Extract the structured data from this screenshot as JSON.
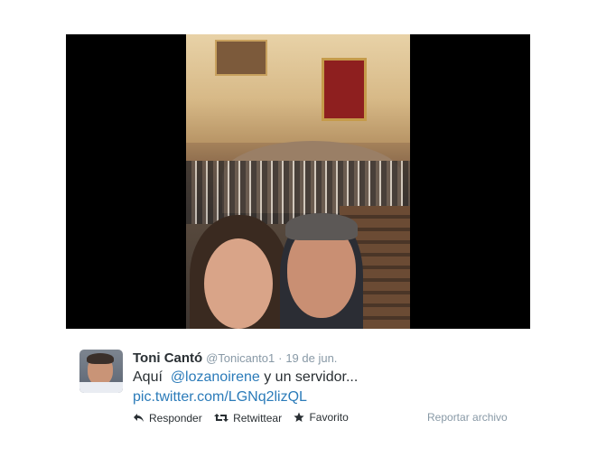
{
  "tweet": {
    "author_name": "Toni Cantó",
    "handle": "@Tonicanto1",
    "separator": "·",
    "timestamp": "19 de jun.",
    "text_prefix": "Aquí",
    "mention": "@lozanoirene",
    "text_suffix": "y un servidor...",
    "link": "pic.twitter.com/LGNq2lizQL"
  },
  "actions": {
    "reply_label": "Responder",
    "retweet_label": "Retwittear",
    "favorite_label": "Favorito",
    "report_label": "Reportar archivo"
  },
  "icons": {
    "reply": "reply-icon",
    "retweet": "retweet-icon",
    "favorite": "star-icon"
  },
  "colors": {
    "link": "#2b7bb9",
    "muted": "#8899a6",
    "text": "#292f33"
  }
}
